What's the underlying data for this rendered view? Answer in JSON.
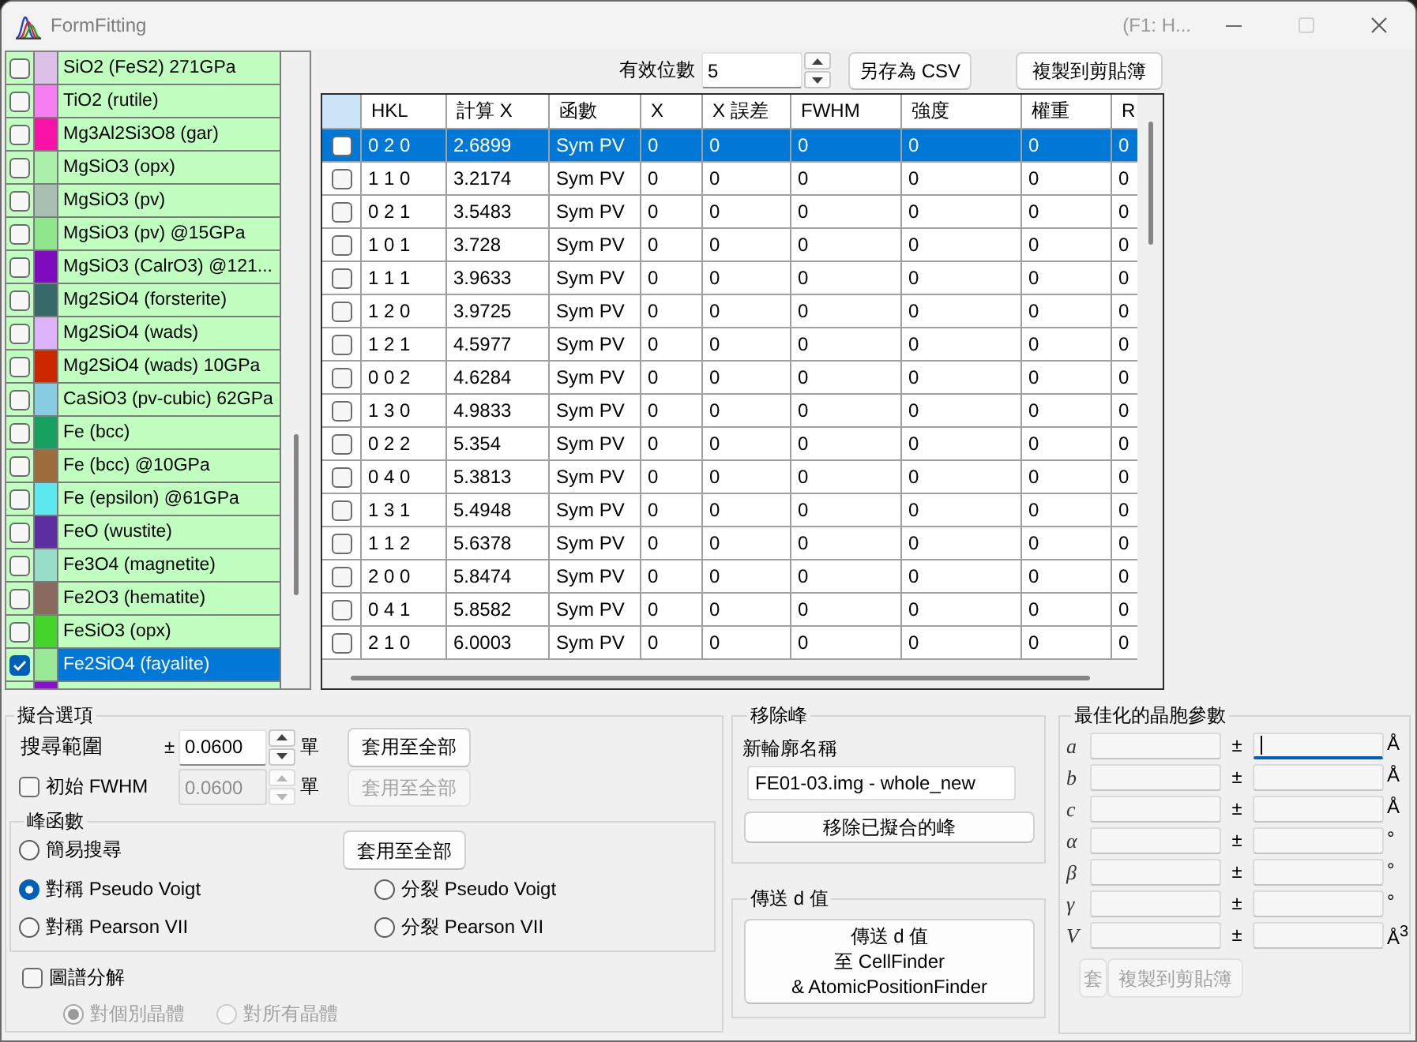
{
  "window": {
    "title": "FormFitting",
    "hint": "(F1: H..."
  },
  "phases": [
    {
      "name": "SiO2 (FeS2) 271GPa",
      "color": "#dcc0e8",
      "checked": false,
      "selected": false
    },
    {
      "name": "TiO2 (rutile)",
      "color": "#f77ef0",
      "checked": false,
      "selected": false
    },
    {
      "name": "Mg3Al2Si3O8 (gar)",
      "color": "#f812a8",
      "checked": false,
      "selected": false
    },
    {
      "name": "MgSiO3 (opx)",
      "color": "#aaf0aa",
      "checked": false,
      "selected": false
    },
    {
      "name": "MgSiO3 (pv)",
      "color": "#a8c0b2",
      "checked": false,
      "selected": false
    },
    {
      "name": "MgSiO3 (pv) @15GPa",
      "color": "#90e68c",
      "checked": false,
      "selected": false
    },
    {
      "name": "MgSiO3 (CalrO3) @121...",
      "color": "#7e0cbe",
      "checked": false,
      "selected": false
    },
    {
      "name": "Mg2SiO4 (forsterite)",
      "color": "#366868",
      "checked": false,
      "selected": false
    },
    {
      "name": "Mg2SiO4 (wads)",
      "color": "#dcb2f8",
      "checked": false,
      "selected": false
    },
    {
      "name": "Mg2SiO4 (wads) 10GPa",
      "color": "#cc2800",
      "checked": false,
      "selected": false
    },
    {
      "name": "CaSiO3 (pv-cubic) 62GPa",
      "color": "#88cce2",
      "checked": false,
      "selected": false
    },
    {
      "name": "Fe (bcc)",
      "color": "#16a060",
      "checked": false,
      "selected": false
    },
    {
      "name": "Fe (bcc) @10GPa",
      "color": "#9c6c3a",
      "checked": false,
      "selected": false
    },
    {
      "name": "Fe (epsilon) @61GPa",
      "color": "#5ce8ee",
      "checked": false,
      "selected": false
    },
    {
      "name": "FeO (wustite)",
      "color": "#5c2ea0",
      "checked": false,
      "selected": false
    },
    {
      "name": "Fe3O4 (magnetite)",
      "color": "#98dcca",
      "checked": false,
      "selected": false
    },
    {
      "name": "Fe2O3 (hematite)",
      "color": "#8a6a5e",
      "checked": false,
      "selected": false
    },
    {
      "name": "FeSiO3 (opx)",
      "color": "#44d42c",
      "checked": false,
      "selected": false
    },
    {
      "name": "Fe2SiO4 (fayalite)",
      "color": "#98e898",
      "checked": true,
      "selected": true
    },
    {
      "color": "#8a10d0"
    }
  ],
  "digits": {
    "label": "有效位數",
    "value": "5"
  },
  "toolbar_buttons": [
    "另存為 CSV",
    "複製到剪貼簿"
  ],
  "table": {
    "columns": [
      "HKL",
      "計算 X",
      "函數",
      "X",
      "X 誤差",
      "FWHM",
      "強度",
      "權重",
      "R"
    ],
    "rows": [
      {
        "checked": false,
        "selected": true,
        "cells": [
          "0 2 0",
          "2.6899",
          "Sym PV",
          "0",
          "0",
          "0",
          "0",
          "0",
          "0"
        ]
      },
      {
        "checked": false,
        "selected": false,
        "cells": [
          "1 1 0",
          "3.2174",
          "Sym PV",
          "0",
          "0",
          "0",
          "0",
          "0",
          "0"
        ]
      },
      {
        "checked": false,
        "selected": false,
        "cells": [
          "0 2 1",
          "3.5483",
          "Sym PV",
          "0",
          "0",
          "0",
          "0",
          "0",
          "0"
        ]
      },
      {
        "checked": false,
        "selected": false,
        "cells": [
          "1 0 1",
          "3.728",
          "Sym PV",
          "0",
          "0",
          "0",
          "0",
          "0",
          "0"
        ]
      },
      {
        "checked": false,
        "selected": false,
        "cells": [
          "1 1 1",
          "3.9633",
          "Sym PV",
          "0",
          "0",
          "0",
          "0",
          "0",
          "0"
        ]
      },
      {
        "checked": false,
        "selected": false,
        "cells": [
          "1 2 0",
          "3.9725",
          "Sym PV",
          "0",
          "0",
          "0",
          "0",
          "0",
          "0"
        ]
      },
      {
        "checked": false,
        "selected": false,
        "cells": [
          "1 2 1",
          "4.5977",
          "Sym PV",
          "0",
          "0",
          "0",
          "0",
          "0",
          "0"
        ]
      },
      {
        "checked": false,
        "selected": false,
        "cells": [
          "0 0 2",
          "4.6284",
          "Sym PV",
          "0",
          "0",
          "0",
          "0",
          "0",
          "0"
        ]
      },
      {
        "checked": false,
        "selected": false,
        "cells": [
          "1 3 0",
          "4.9833",
          "Sym PV",
          "0",
          "0",
          "0",
          "0",
          "0",
          "0"
        ]
      },
      {
        "checked": false,
        "selected": false,
        "cells": [
          "0 2 2",
          "5.354",
          "Sym PV",
          "0",
          "0",
          "0",
          "0",
          "0",
          "0"
        ]
      },
      {
        "checked": false,
        "selected": false,
        "cells": [
          "0 4 0",
          "5.3813",
          "Sym PV",
          "0",
          "0",
          "0",
          "0",
          "0",
          "0"
        ]
      },
      {
        "checked": false,
        "selected": false,
        "cells": [
          "1 3 1",
          "5.4948",
          "Sym PV",
          "0",
          "0",
          "0",
          "0",
          "0",
          "0"
        ]
      },
      {
        "checked": false,
        "selected": false,
        "cells": [
          "1 1 2",
          "5.6378",
          "Sym PV",
          "0",
          "0",
          "0",
          "0",
          "0",
          "0"
        ]
      },
      {
        "checked": false,
        "selected": false,
        "cells": [
          "2 0 0",
          "5.8474",
          "Sym PV",
          "0",
          "0",
          "0",
          "0",
          "0",
          "0"
        ]
      },
      {
        "checked": false,
        "selected": false,
        "cells": [
          "0 4 1",
          "5.8582",
          "Sym PV",
          "0",
          "0",
          "0",
          "0",
          "0",
          "0"
        ]
      },
      {
        "checked": false,
        "selected": false,
        "cells": [
          "2 1 0",
          "6.0003",
          "Sym PV",
          "0",
          "0",
          "0",
          "0",
          "0",
          "0"
        ]
      }
    ]
  },
  "fit_options": {
    "title": "擬合選項",
    "search_range": {
      "label": "搜尋範圍",
      "sign": "±",
      "value": "0.0600",
      "unit": "單",
      "button": "套用至全部"
    },
    "initial_fwhm": {
      "label": "初始 FWHM",
      "checked": false,
      "disabled": true,
      "value": "0.0600",
      "unit": "單",
      "button": "套用至全部"
    },
    "peak_function": {
      "title": "峰函數",
      "button": "套用至全部",
      "options": [
        {
          "label": "簡易搜尋",
          "selected": false
        },
        {
          "label": "對稱 Pseudo Voigt",
          "selected": true
        },
        {
          "label": "分裂 Pseudo Voigt",
          "selected": false
        },
        {
          "label": "對稱 Pearson VII",
          "selected": false
        },
        {
          "label": "分裂 Pearson VII",
          "selected": false
        }
      ]
    },
    "decomposition": {
      "label": "圖譜分解",
      "checked": false,
      "options": [
        {
          "label": "對個別晶體",
          "selected": true,
          "disabled": true
        },
        {
          "label": "對所有晶體",
          "selected": false,
          "disabled": true
        }
      ]
    }
  },
  "remove_peaks": {
    "title": "移除峰",
    "name_label": "新輪廓名稱",
    "name_value": "FE01-03.img - whole_new",
    "button": "移除已擬合的峰"
  },
  "send_d": {
    "title": "傳送 d 值",
    "button_lines": [
      "傳送 d 值",
      "至 CellFinder",
      "& AtomicPositionFinder"
    ]
  },
  "cell_params": {
    "title": "最佳化的晶胞參數",
    "params": [
      {
        "symbol": "a",
        "sign": "±",
        "unit": "Å",
        "focused": true
      },
      {
        "symbol": "b",
        "sign": "±",
        "unit": "Å",
        "focused": false
      },
      {
        "symbol": "c",
        "sign": "±",
        "unit": "Å",
        "focused": false
      },
      {
        "symbol": "α",
        "sign": "±",
        "unit": "°",
        "focused": false
      },
      {
        "symbol": "β",
        "sign": "±",
        "unit": "°",
        "focused": false
      },
      {
        "symbol": "γ",
        "sign": "±",
        "unit": "°",
        "focused": false
      },
      {
        "symbol": "V",
        "sign": "±",
        "unit": "Å$^{3}$",
        "focused": false
      }
    ],
    "buttons": [
      {
        "label": "套",
        "disabled": true
      },
      {
        "label": "複製到剪貼簿",
        "disabled": true
      }
    ]
  }
}
